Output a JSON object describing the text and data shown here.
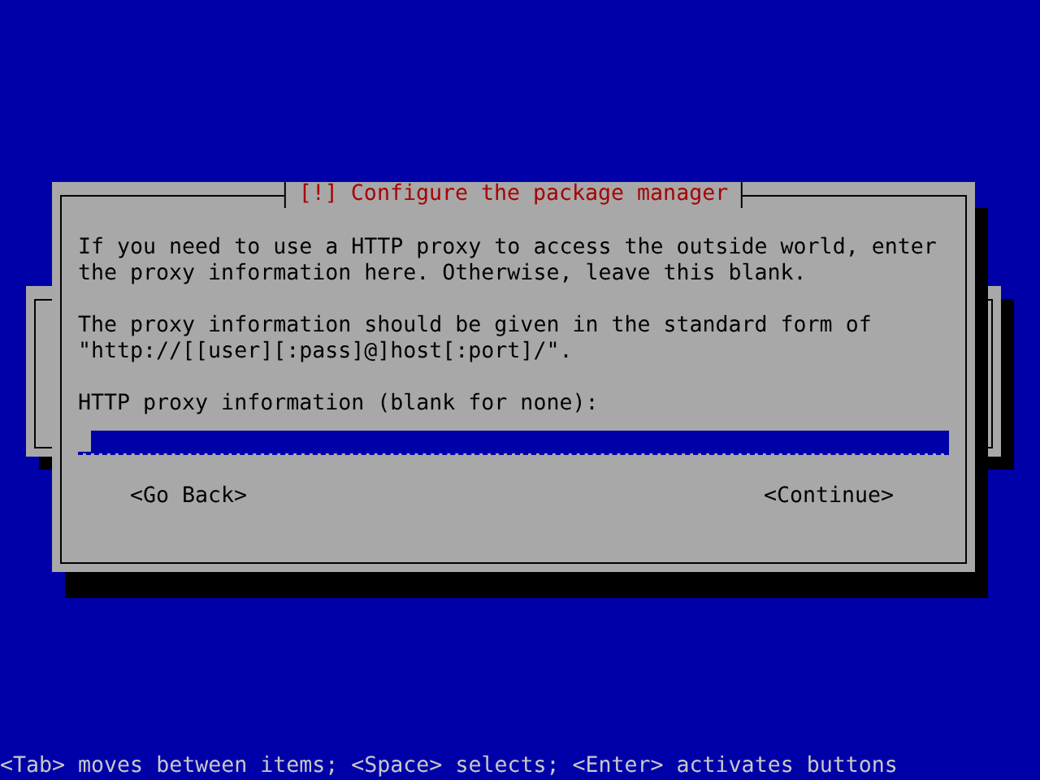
{
  "dialog": {
    "title": "[!] Configure the package manager",
    "paragraphs": [
      "If you need to use a HTTP proxy to access the outside world, enter\nthe proxy information here. Otherwise, leave this blank.",
      "The proxy information should be given in the standard form of\n\"http://[[user][:pass]@]host[:port]/\"."
    ],
    "field": {
      "label": "HTTP proxy information (blank for none):",
      "focused": true
    },
    "buttons": [
      {
        "label": "<Go Back>"
      },
      {
        "label": "<Continue>"
      }
    ]
  },
  "status_bar": "<Tab> moves between items; <Space> selects; <Enter> activates buttons"
}
